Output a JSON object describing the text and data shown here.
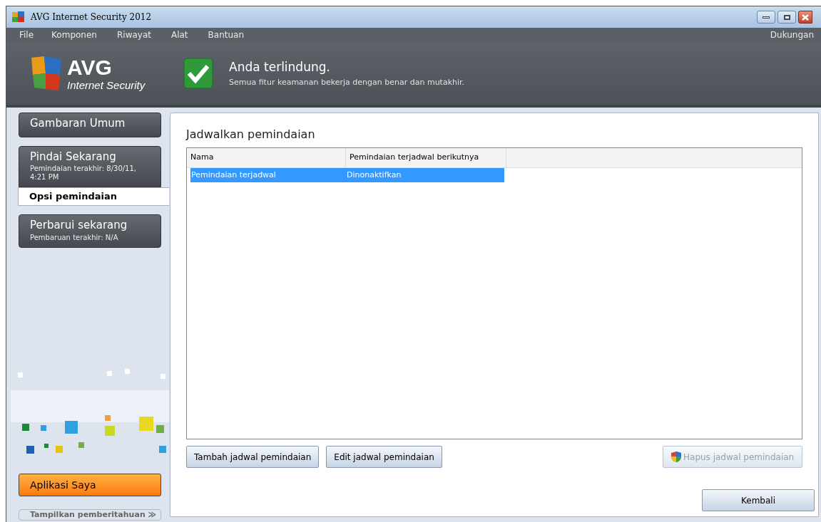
{
  "window": {
    "title": "AVG Internet Security 2012"
  },
  "menu": {
    "items": [
      "File",
      "Komponen",
      "Riwayat",
      "Alat",
      "Bantuan"
    ],
    "right": "Dukungan"
  },
  "header": {
    "logo_name": "AVG",
    "logo_product": "Internet Security",
    "status_title": "Anda terlindung.",
    "status_text": "Semua fitur keamanan bekerja dengan benar dan mutakhir."
  },
  "sidebar": {
    "items": [
      {
        "kind": "section",
        "title": "Gambaran Umum"
      },
      {
        "kind": "section",
        "title": "Pindai Sekarang",
        "subtitle": "Pemindaian terakhir: 8/30/11, 4:21 PM"
      },
      {
        "kind": "subitem",
        "title": "Opsi pemindaian",
        "selected": true
      },
      {
        "kind": "section",
        "title": "Perbarui sekarang",
        "subtitle": "Pembaruan terakhir: N/A"
      }
    ],
    "apps_button": "Aplikasi Saya",
    "notifications_toggle": "Tampilkan pemberitahuan",
    "notifications_glyph": "≫"
  },
  "panel": {
    "title": "Jadwalkan pemindaian",
    "table": {
      "columns": [
        "Nama",
        "Pemindaian terjadwal berikutnya"
      ],
      "rows": [
        {
          "cells": [
            "Pemindaian terjadwal",
            "Dinonaktifkan"
          ],
          "selected": true
        }
      ]
    },
    "buttons": [
      {
        "label": "Tambah jadwal pemindaian",
        "disabled": false
      },
      {
        "label": "Edit jadwal pemindaian",
        "disabled": false
      },
      {
        "label": "Hapus jadwal pemindaian",
        "disabled": true
      }
    ],
    "back_button": "Kembali"
  }
}
